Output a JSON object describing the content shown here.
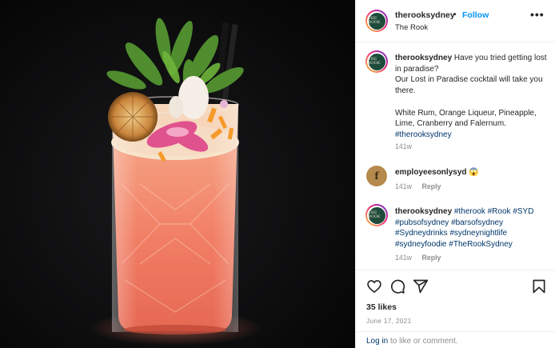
{
  "post": {
    "header": {
      "username": "therooksydney",
      "dot": "•",
      "follow_label": "Follow",
      "location": "The Rook",
      "avatar_text": "THE ROOK",
      "more_label": "•••"
    },
    "caption": {
      "username": "therooksydney",
      "line1": "Have you tried getting lost in paradise?",
      "line2": "Our Lost in Paradise cocktail will take you there.",
      "line3": "White Rum, Orange Liqueur, Pineapple, Lime, Cranberry and Falernum.",
      "hashtag": "#therooksydney",
      "time": "141w"
    },
    "comments": [
      {
        "username": "employeesonlysyd",
        "emoji": "😱",
        "avatar_text": "f",
        "time": "141w",
        "reply_label": "Reply"
      },
      {
        "username": "therooksydney",
        "avatar_text": "THE ROOK",
        "hashtags": [
          "#therook",
          "#Rook",
          "#SYD",
          "#pubsofsydney",
          "#barsofsydney",
          "#Sydneydrinks",
          "#sydneynightlife",
          "#sydneyfoodie",
          "#TheRookSydney"
        ],
        "time": "141w",
        "reply_label": "Reply"
      }
    ],
    "likes": "35 likes",
    "date": "June 17, 2021",
    "login_link": "Log in",
    "login_text": " to like or comment."
  },
  "icons": [
    "heart-icon",
    "comment-icon",
    "share-icon",
    "bookmark-icon"
  ],
  "colors": {
    "link": "#0095f6",
    "hashtag": "#00376b",
    "muted": "#8e8e8e",
    "photo_background": "#0b0b0c",
    "avatar_green": "#1f4b3b"
  }
}
